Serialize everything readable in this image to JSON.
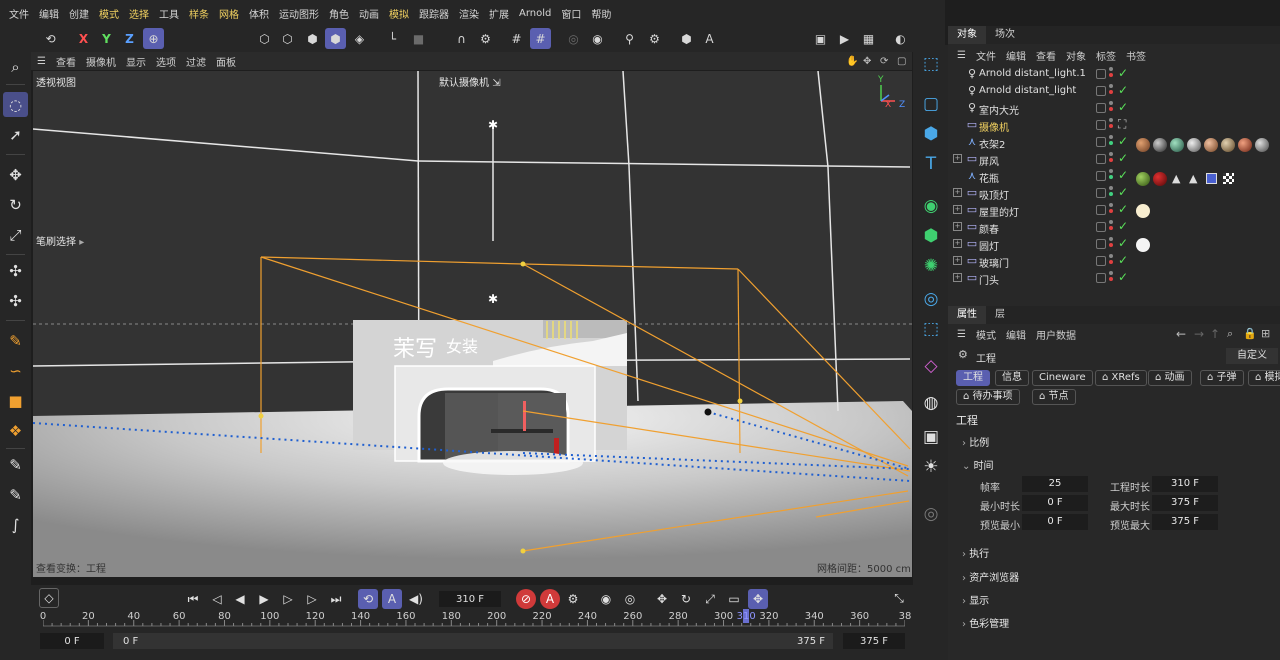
{
  "menubar": [
    "文件",
    "编辑",
    "创建",
    "模式",
    "选择",
    "工具",
    "样条",
    "网格",
    "体积",
    "运动图形",
    "角色",
    "动画",
    "模拟",
    "跟踪器",
    "渲染",
    "扩展",
    "Arnold",
    "窗口",
    "帮助"
  ],
  "menubar_highlight": [
    "模式",
    "选择",
    "样条",
    "网格",
    "模拟"
  ],
  "toolbar": {
    "x": "X",
    "y": "Y",
    "z": "Z"
  },
  "viewport_menu": [
    "查看",
    "摄像机",
    "显示",
    "选项",
    "过滤",
    "面板"
  ],
  "viewport": {
    "view_name": "透视视图",
    "camera_name": "默认摄像机",
    "brush_label": "笔刷选择",
    "transform_label": "查看变换：工程",
    "grid_label": "网格间距：5000 cm",
    "store_sign_main": "茉写",
    "store_sign_sub": "女装"
  },
  "timeline": {
    "current_frame": "310 F",
    "start_field": "0 F",
    "start_field2": "0 F",
    "end_field": "375 F",
    "end_field2": "375 F",
    "ruler_labels": [
      "0",
      "20",
      "40",
      "60",
      "80",
      "100",
      "120",
      "140",
      "160",
      "180",
      "200",
      "220",
      "240",
      "260",
      "280",
      "300",
      "310",
      "320",
      "340",
      "360",
      "38"
    ],
    "current": "310"
  },
  "object_manager": {
    "tabs": [
      "对象",
      "场次"
    ],
    "menu": [
      "文件",
      "编辑",
      "查看",
      "对象",
      "标签",
      "书签"
    ],
    "rows": [
      {
        "name": "Arnold distant_light.1",
        "icon": "bulb-icon",
        "expand": false
      },
      {
        "name": "Arnold distant_light",
        "icon": "bulb-icon",
        "expand": false
      },
      {
        "name": "室内大光",
        "icon": "bulb-icon",
        "expand": false
      },
      {
        "name": "摄像机",
        "icon": "camera-icon",
        "expand": false,
        "highlight": true
      },
      {
        "name": "衣架2",
        "icon": "null-icon",
        "expand": false
      },
      {
        "name": "屏风",
        "icon": "folder-icon",
        "expand": true
      },
      {
        "name": "花瓶",
        "icon": "null-icon",
        "expand": false
      },
      {
        "name": "吸顶灯",
        "icon": "folder-icon",
        "expand": true
      },
      {
        "name": "屋里的灯",
        "icon": "folder-icon",
        "expand": true
      },
      {
        "name": "颜春",
        "icon": "folder-icon",
        "expand": true
      },
      {
        "name": "圆灯",
        "icon": "folder-icon",
        "expand": true
      },
      {
        "name": "玻璃门",
        "icon": "folder-icon",
        "expand": true
      },
      {
        "name": "门头",
        "icon": "folder-icon",
        "expand": true
      }
    ]
  },
  "attributes": {
    "tabs": [
      "属性",
      "层"
    ],
    "menu": [
      "模式",
      "编辑",
      "用户数据"
    ],
    "object_label": "工程",
    "custom_label": "自定义",
    "subtabs": [
      "工程",
      "信息",
      "Cineware",
      "XRefs",
      "动画",
      "子弹",
      "模拟"
    ],
    "subtabs2": [
      "待办事项",
      "节点"
    ],
    "section_title": "工程",
    "sections": [
      "比例",
      "时间",
      "执行",
      "资产浏览器",
      "显示",
      "色彩管理"
    ],
    "fields": {
      "fps_label": "帧率",
      "fps": "25",
      "duration_label": "工程时长",
      "duration": "310 F",
      "min_label": "最小时长",
      "min": "0 F",
      "max_label": "最大时长",
      "max": "375 F",
      "preview_min_label": "预览最小",
      "preview_min": "0 F",
      "preview_max_label": "预览最大",
      "preview_max": "375 F"
    }
  },
  "colors": {
    "accent": "#5a5fb0",
    "highlight": "#f0d060",
    "check": "#5ae05a",
    "orange": "#f0a030"
  }
}
